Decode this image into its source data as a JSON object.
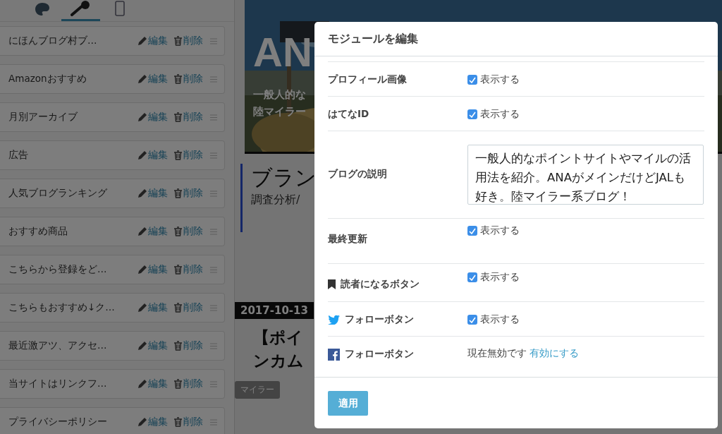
{
  "sidebar": {
    "tabs": [
      {
        "kind": "palette",
        "selected": false
      },
      {
        "kind": "wrench",
        "selected": true
      },
      {
        "kind": "phone",
        "selected": false
      }
    ],
    "modules": [
      {
        "name": "にほんブログ村ブ…",
        "edit": "編集",
        "delete": "削除"
      },
      {
        "name": "Amazonおすすめ",
        "edit": "編集",
        "delete": "削除"
      },
      {
        "name": "月別アーカイブ",
        "edit": "編集",
        "delete": "削除"
      },
      {
        "name": "広告",
        "edit": "編集",
        "delete": "削除"
      },
      {
        "name": "人気ブログランキング",
        "edit": "編集",
        "delete": "削除"
      },
      {
        "name": "おすすめ商品",
        "edit": "編集",
        "delete": "削除"
      },
      {
        "name": "こちらから登録をど…",
        "edit": "編集",
        "delete": "削除"
      },
      {
        "name": "こちらもおすすめ↓ク…",
        "edit": "編集",
        "delete": "削除"
      },
      {
        "name": "最近激アツ、アクセ…",
        "edit": "編集",
        "delete": "削除"
      },
      {
        "name": "当サイトはリンクフ…",
        "edit": "編集",
        "delete": "削除"
      },
      {
        "name": "プライバシーポリシー",
        "edit": "編集",
        "delete": "削除"
      }
    ]
  },
  "preview": {
    "header_title": "AN",
    "header_lines": [
      "一般人的な",
      "陸マイラー"
    ],
    "section_title": "ブラン",
    "section_subtitle": "調査分析/",
    "date": "2017-10-13",
    "post_title_lines": [
      "【ポイ",
      "ンカム"
    ],
    "tag": "マイラー"
  },
  "modal": {
    "title": "モジュールを編集",
    "rows": [
      {
        "kind": "checkbox",
        "label": "プロフィール画像",
        "checked": true,
        "option": "表示する"
      },
      {
        "kind": "checkbox",
        "label": "はてなID",
        "checked": true,
        "option": "表示する"
      },
      {
        "kind": "textarea",
        "label": "ブログの説明",
        "value": "一般人的なポイントサイトやマイルの活用法を紹介。ANAがメインだけどJALも好き。陸マイラー系ブログ！"
      },
      {
        "kind": "checkbox",
        "label": "最終更新",
        "checked": true,
        "option": "表示する"
      },
      {
        "kind": "checkbox",
        "label": "読者になるボタン",
        "checked": true,
        "option": "表示する"
      },
      {
        "kind": "checkbox",
        "label": "フォローボタン",
        "checked": true,
        "option": "表示する"
      },
      {
        "kind": "status",
        "label": "フォローボタン",
        "status": "現在無効です",
        "action": "有効にする"
      }
    ],
    "apply": "適用"
  }
}
